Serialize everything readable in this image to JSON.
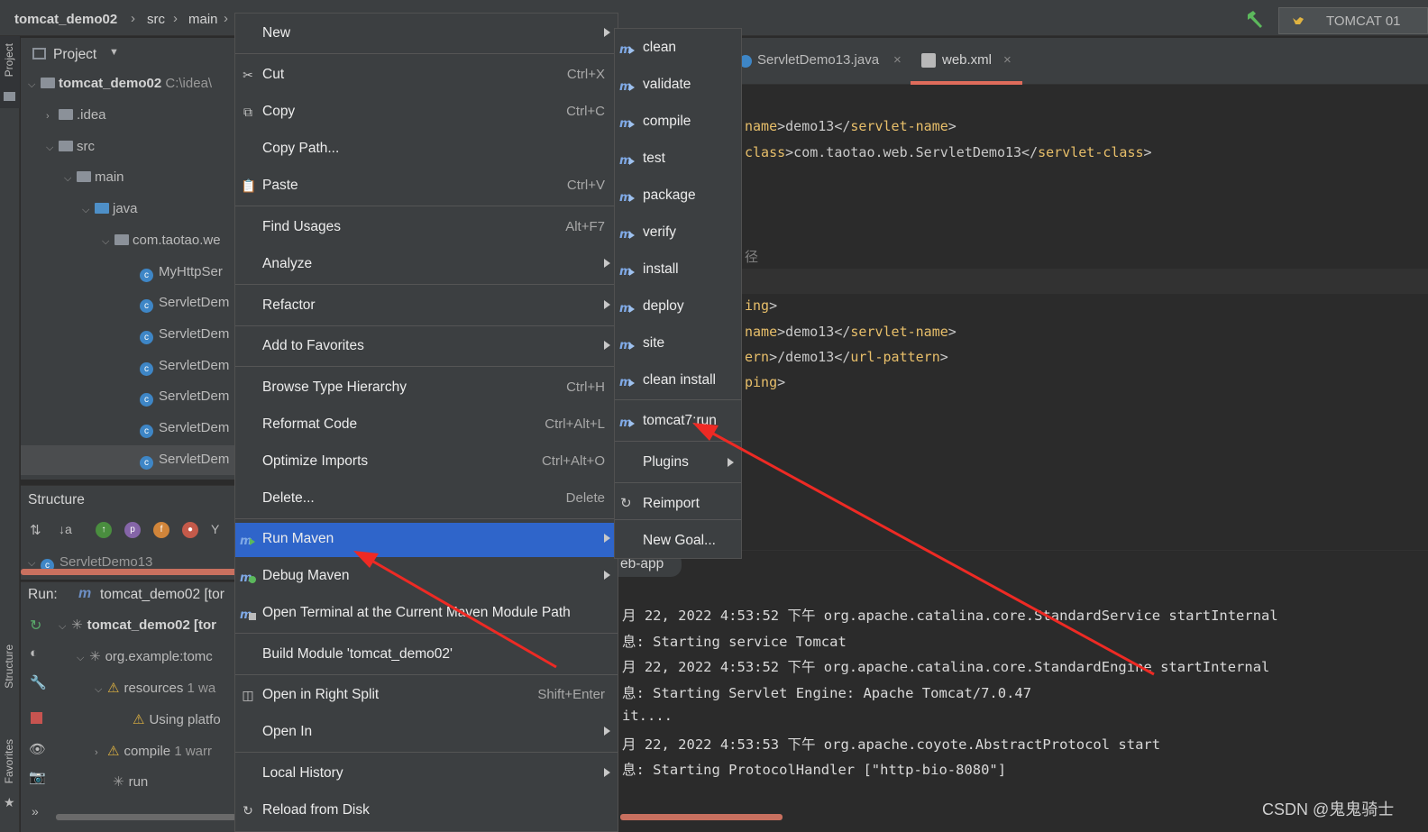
{
  "breadcrumb": [
    "tomcat_demo02",
    "src",
    "main"
  ],
  "run_config": {
    "label": "TOMCAT 01"
  },
  "sidebar": {
    "project_label": "Project",
    "structure_label": "Structure",
    "favorites_label": "Favorites"
  },
  "project_panel": {
    "title": "Project",
    "tree": [
      {
        "label": "tomcat_demo02",
        "hint": "C:\\idea\\",
        "bold": true
      },
      {
        "label": ".idea"
      },
      {
        "label": "src"
      },
      {
        "label": "main"
      },
      {
        "label": "java"
      },
      {
        "label": "com.taotao.we"
      },
      {
        "label": "MyHttpSer"
      },
      {
        "label": "ServletDem"
      },
      {
        "label": "ServletDem"
      },
      {
        "label": "ServletDem"
      },
      {
        "label": "ServletDem"
      },
      {
        "label": "ServletDem"
      },
      {
        "label": "ServletDem"
      }
    ]
  },
  "structure_panel": {
    "title": "Structure",
    "item": "ServletDemo13"
  },
  "run_panel": {
    "label": "Run:",
    "config": "tomcat_demo02 [tor",
    "tree": [
      {
        "label": "tomcat_demo02 [tor"
      },
      {
        "label": "org.example:tomc"
      },
      {
        "label": "resources",
        "hint": "1 wa"
      },
      {
        "label": "Using platfo"
      },
      {
        "label": "compile",
        "hint": "1 warr"
      },
      {
        "label": "run"
      }
    ]
  },
  "editor": {
    "tabs": [
      "ServletDemo13.java",
      "web.xml"
    ],
    "lines": [
      {
        "pre": "name",
        "mid": ">demo13</",
        "tag": "servlet-name",
        "post": ">"
      },
      {
        "pre": "class",
        "mid": ">com.taotao.web.ServletDemo13</",
        "tag": "servlet-class",
        "post": ">"
      },
      {
        "pre": "径",
        "mid": "",
        "tag": "",
        "post": ""
      },
      {
        "pre": "ing",
        "mid": ">",
        "tag": "",
        "post": ""
      },
      {
        "pre": "name",
        "mid": ">demo13</",
        "tag": "servlet-name",
        "post": ">"
      },
      {
        "pre": "ern",
        "mid": ">/demo13</",
        "tag": "url-pattern",
        "post": ">"
      },
      {
        "pre": "ping",
        "mid": ">",
        "tag": "",
        "post": ""
      }
    ]
  },
  "console": {
    "tab": "eb-app",
    "lines": [
      "月 22, 2022 4:53:52 下午 org.apache.catalina.core.StandardService startInternal",
      "息: Starting service Tomcat",
      "月 22, 2022 4:53:52 下午 org.apache.catalina.core.StandardEngine startInternal",
      "息: Starting Servlet Engine: Apache Tomcat/7.0.47",
      "it....",
      "月 22, 2022 4:53:53 下午 org.apache.coyote.AbstractProtocol start",
      "息: Starting ProtocolHandler [\"http-bio-8080\"]"
    ]
  },
  "context_menu": [
    {
      "label": "New",
      "shortcut": "",
      "submenu": true
    },
    {
      "label": "Cut",
      "shortcut": "Ctrl+X"
    },
    {
      "label": "Copy",
      "shortcut": "Ctrl+C"
    },
    {
      "label": "Copy Path...",
      "shortcut": ""
    },
    {
      "label": "Paste",
      "shortcut": "Ctrl+V"
    },
    {
      "label": "Find Usages",
      "shortcut": "Alt+F7"
    },
    {
      "label": "Analyze",
      "shortcut": "",
      "submenu": true
    },
    {
      "label": "Refactor",
      "shortcut": "",
      "submenu": true
    },
    {
      "label": "Add to Favorites",
      "shortcut": "",
      "submenu": true
    },
    {
      "label": "Browse Type Hierarchy",
      "shortcut": "Ctrl+H"
    },
    {
      "label": "Reformat Code",
      "shortcut": "Ctrl+Alt+L"
    },
    {
      "label": "Optimize Imports",
      "shortcut": "Ctrl+Alt+O"
    },
    {
      "label": "Delete...",
      "shortcut": "Delete"
    },
    {
      "label": "Run Maven",
      "shortcut": "",
      "submenu": true,
      "selected": true
    },
    {
      "label": "Debug Maven",
      "shortcut": "",
      "submenu": true
    },
    {
      "label": "Open Terminal at the Current Maven Module Path",
      "shortcut": ""
    },
    {
      "label": "Build Module 'tomcat_demo02'",
      "shortcut": ""
    },
    {
      "label": "Open in Right Split",
      "shortcut": "Shift+Enter"
    },
    {
      "label": "Open In",
      "shortcut": "",
      "submenu": true
    },
    {
      "label": "Local History",
      "shortcut": "",
      "submenu": true
    },
    {
      "label": "Reload from Disk",
      "shortcut": ""
    }
  ],
  "run_maven_submenu": [
    "clean",
    "validate",
    "compile",
    "test",
    "package",
    "verify",
    "install",
    "deploy",
    "site",
    "clean install",
    "tomcat7:run",
    "Plugins",
    "Reimport",
    "New Goal..."
  ],
  "watermark": "CSDN @鬼鬼骑士",
  "colors": {
    "accent_selection": "#2f65ca",
    "annotation_arrow": "#ee2a24",
    "active_tab_underline": "#e06c5b"
  }
}
